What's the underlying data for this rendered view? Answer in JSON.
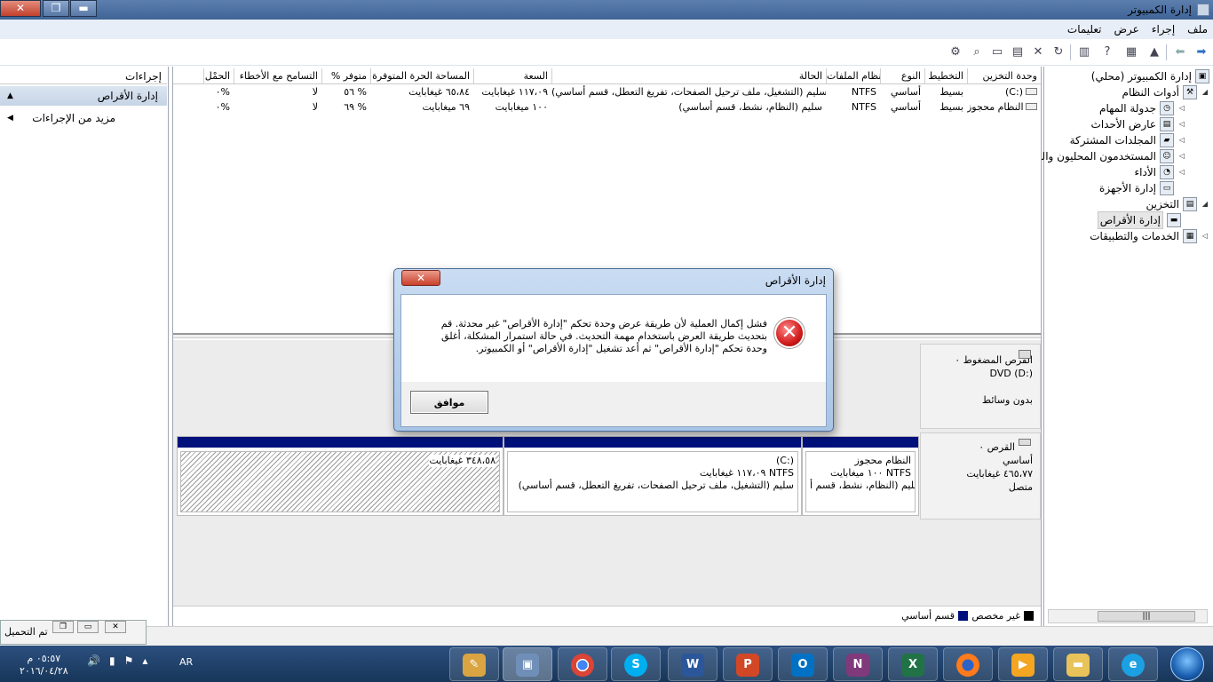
{
  "window": {
    "title": "إدارة الكمبيوتر"
  },
  "menu": {
    "items": [
      "ملف",
      "إجراء",
      "عرض",
      "تعليمات"
    ]
  },
  "tree": {
    "items": [
      {
        "label": "إدارة الكمبيوتر (محلي)",
        "level": 0
      },
      {
        "label": "أدوات النظام",
        "level": 1
      },
      {
        "label": "جدولة المهام",
        "level": 2
      },
      {
        "label": "عارض الأحداث",
        "level": 2
      },
      {
        "label": "المجلدات المشتركة",
        "level": 2
      },
      {
        "label": "المستخدمون المحليون والمجم",
        "level": 2
      },
      {
        "label": "الأداء",
        "level": 2
      },
      {
        "label": "إدارة الأجهزة",
        "level": 2
      },
      {
        "label": "التخزين",
        "level": 1
      },
      {
        "label": "إدارة الأقراص",
        "level": 2
      },
      {
        "label": "الخدمات والتطبيقات",
        "level": 1
      }
    ]
  },
  "volumes": {
    "headers": [
      "وحدة التخزين",
      "التخطيط",
      "النوع",
      "نظام الملفات",
      "الحالة",
      "السعة",
      "المساحة الحرة المتوفرة",
      "% متوفر",
      "التسامح مع الأخطاء",
      "الحمْل"
    ],
    "rows": [
      [
        "(C:)",
        "بسيط",
        "أساسي",
        "NTFS",
        "سليم (التشغيل، ملف ترحيل الصفحات، تفريغ التعطل، قسم أساسي)",
        "١١٧،٠٩ غيغابايت",
        "٦٥،٨٤ غيغابايت",
        "٥٦ %",
        "لا",
        "٠%"
      ],
      [
        "النظام محجوز",
        "بسيط",
        "أساسي",
        "NTFS",
        "سليم (النظام، نشط، قسم أساسي)",
        "١٠٠ ميغابايت",
        "٦٩ ميغابايت",
        "٦٩ %",
        "لا",
        "٠%"
      ]
    ]
  },
  "disks": {
    "dvd": {
      "title": "القرص المضغوط ٠",
      "line2": "DVD (D:)",
      "line3": "بدون وسائط"
    },
    "disk0": {
      "title": "القرص ٠",
      "type": "أساسي",
      "size": "٤٦٥،٧٧ غيغابايت",
      "status": "متصل",
      "partitions": [
        {
          "name": "النظام محجوز",
          "size": "١٠٠ ميغابايت NTFS",
          "status": "سليم (النظام، نشط، قسم أ"
        },
        {
          "name": "(C:)",
          "size": "١١٧،٠٩ غيغابايت NTFS",
          "status": "سليم (التشغيل، ملف ترحيل الصفحات، تفريغ التعطل، قسم أساسي)"
        },
        {
          "name": "",
          "size": "٣٤٨،٥٨ غيغابايت",
          "status": ""
        }
      ]
    }
  },
  "legend": {
    "unallocated": "غير مخصص",
    "primary": "قسم أساسي"
  },
  "actions": {
    "header": "إجراءات",
    "section": "إدارة الأقراص",
    "more": "مزيد من الإجراءات"
  },
  "dialog": {
    "title": "إدارة الأقراص",
    "message": "فشل إكمال العملية لأن طريقة عرض وحدة تحكم \"إدارة الأقراص\" غير محدثة. قم بتحديث طريقة العرض باستخدام مهمة التحديث. في حالة استمرار المشكلة، أغلق وحدة تحكم \"إدارة الأقراص\" ثم أعد تشغيل \"إدارة الأقراص\" أو الكمبيوتر.",
    "ok": "موافق"
  },
  "loadwin": {
    "text": "تم التحميل"
  },
  "taskbar": {
    "time": "٠٥:٥٧ م",
    "date": "٢٠١٦/٠٤/٢٨",
    "lang": "AR"
  },
  "colors": {
    "primary_partition": "#00117c",
    "title_bar": "#3f6496"
  }
}
